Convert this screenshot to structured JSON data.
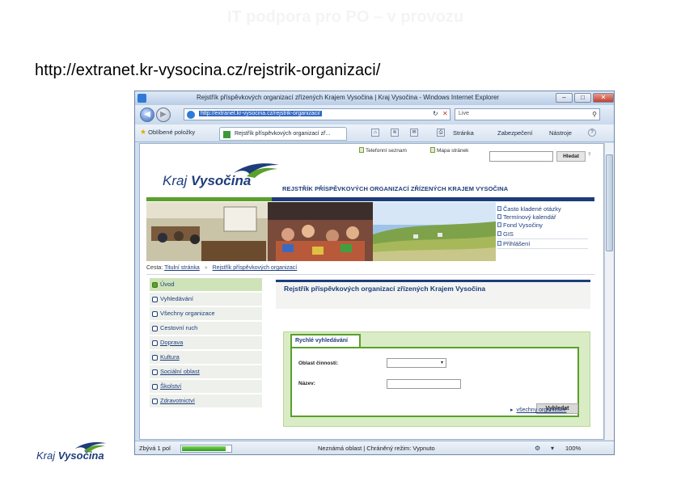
{
  "slide": {
    "title": "IT podpora pro PO – v provozu",
    "url": "http://extranet.kr-vysocina.cz/rejstrik-organizaci/"
  },
  "browser": {
    "window_title": "Rejstřík příspěvkových organizací zřízených Krajem Vysočina | Kraj Vysočina - Windows Internet Explorer",
    "address": "http://extranet.kr-vysocina.cz/rejstrik-organizaci/",
    "search_placeholder": "Live",
    "favorites_label": "Oblíbené položky",
    "tab_title": "Rejstřík příspěvkových organizací zř...",
    "commands": {
      "page": "Stránka",
      "safety": "Zabezpečení",
      "tools": "Nástroje"
    },
    "status": {
      "text": "Zbývá 1 pol",
      "progress_fraction": 0.9,
      "zone": "Neznámá oblast | Chráněný režim: Vypnuto",
      "zoom": "100%"
    }
  },
  "site": {
    "top_links": {
      "phone": "Telefonní seznam",
      "sitemap": "Mapa stránek"
    },
    "search_button": "Hledat",
    "help": "?",
    "logo": {
      "kraj": "Kraj",
      "vysocina": "Vysočina"
    },
    "header_heading": "REJSTŘÍK PŘÍSPĚVKOVÝCH ORGANIZACÍ ZŘÍZENÝCH KRAJEM VYSOČINA",
    "quick_links": [
      "Často kladené otázky",
      "Termínový kalendář",
      "Fond Vysočiny",
      "GIS",
      "Přihlášení"
    ],
    "breadcrumb": {
      "prefix": "Cesta:",
      "home": "Titulní stránka",
      "sep": "»",
      "current": "Rejstřík příspěvkových organizací"
    },
    "sidenav": [
      {
        "label": "Úvod",
        "active": true,
        "linked": false
      },
      {
        "label": "Vyhledávání",
        "active": false,
        "linked": false
      },
      {
        "label": "Všechny organizace",
        "active": false,
        "linked": false
      },
      {
        "label": "Cestovní ruch",
        "active": false,
        "linked": false
      },
      {
        "label": "Doprava",
        "active": false,
        "linked": true
      },
      {
        "label": "Kultura",
        "active": false,
        "linked": true
      },
      {
        "label": "Sociální oblast",
        "active": false,
        "linked": true
      },
      {
        "label": "Školství",
        "active": false,
        "linked": true
      },
      {
        "label": "Zdravotnictví",
        "active": false,
        "linked": true
      }
    ],
    "main_title": "Rejstřík příspěvkových organizací zřízených Krajem Vysočina",
    "quick_search": {
      "header": "Rychlé vyhledávání",
      "field_activity_label": "Oblast činnosti:",
      "field_name_label": "Název:",
      "button": "Vyhledat",
      "all_link": "všechny organizace"
    }
  },
  "footer": {
    "kraj": "Kraj",
    "vysocina": "Vysočina"
  },
  "colors": {
    "brand_blue": "#1d3d7a",
    "brand_green": "#5aa02c"
  }
}
